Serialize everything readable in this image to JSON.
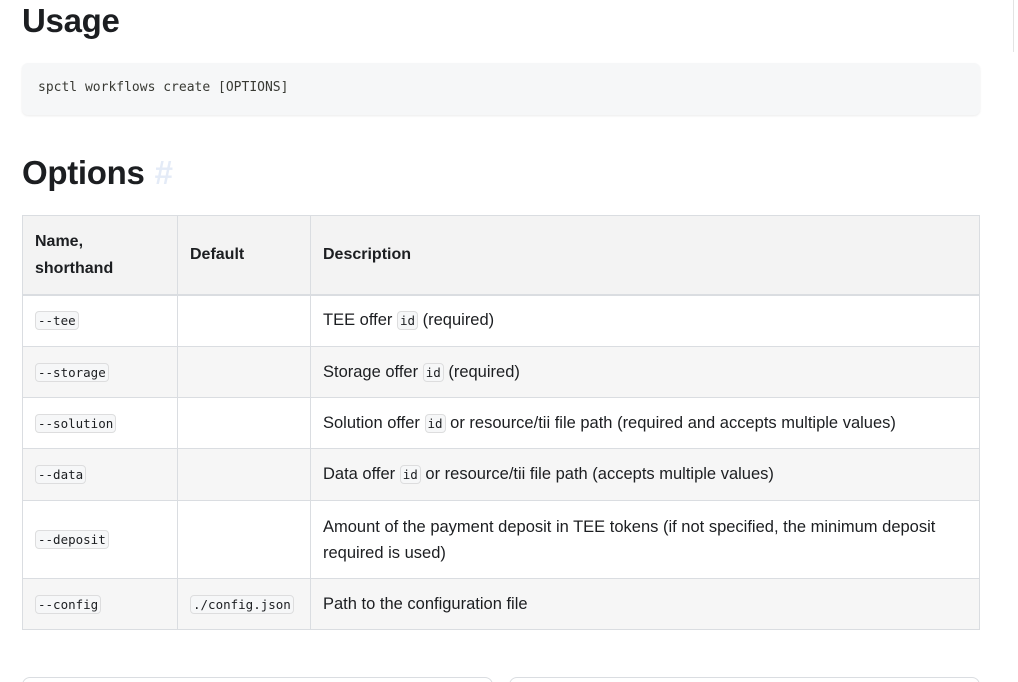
{
  "usage": {
    "heading": "Usage",
    "command": "spctl workflows create [OPTIONS]"
  },
  "options": {
    "heading": "Options",
    "anchor": "#",
    "columns": [
      "Name, shorthand",
      "Default",
      "Description"
    ],
    "column_lines": [
      "Name,",
      "shorthand"
    ],
    "rows": [
      {
        "name": "--tee",
        "default": "",
        "desc": {
          "before": "TEE offer ",
          "code": "id",
          "after": " (required)"
        }
      },
      {
        "name": "--storage",
        "default": "",
        "desc": {
          "before": "Storage offer ",
          "code": "id",
          "after": " (required)"
        }
      },
      {
        "name": "--solution",
        "default": "",
        "desc": {
          "before": "Solution offer ",
          "code": "id",
          "after": " or resource/tii file path (required and accepts multiple values)"
        }
      },
      {
        "name": "--data",
        "default": "",
        "desc": {
          "before": "Data offer ",
          "code": "id",
          "after": " or resource/tii file path (accepts multiple values)"
        }
      },
      {
        "name": "--deposit",
        "default": "",
        "desc": {
          "before": "Amount of the payment deposit in TEE tokens (if not specified, the minimum deposit required is used)",
          "code": "",
          "after": ""
        }
      },
      {
        "name": "--config",
        "default": "./config.json",
        "desc": {
          "before": "Path to the configuration file",
          "code": "",
          "after": ""
        }
      }
    ]
  }
}
